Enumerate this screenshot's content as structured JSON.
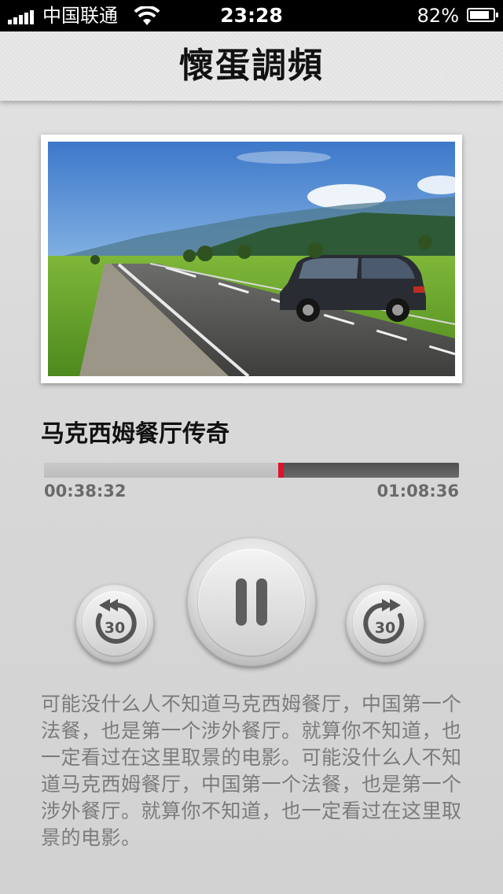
{
  "status_bar": {
    "carrier": "中国联通",
    "time": "23:28",
    "battery": "82%"
  },
  "header": {
    "logo_text": "懷蛋調頻"
  },
  "episode": {
    "title": "马克西姆餐厅传奇",
    "elapsed": "00:38:32",
    "total": "01:08:36",
    "progress_fraction": 0.57,
    "description": "可能没什么人不知道马克西姆餐厅，中国第一个法餐，也是第一个涉外餐厅。就算你不知道，也一定看过在这里取景的电影。可能没什么人不知道马克西姆餐厅，中国第一个法餐，也是第一个涉外餐厅。就算你不知道，也一定看过在这里取景的电影。"
  },
  "controls": {
    "rewind_label": "30",
    "forward_label": "30",
    "rewind_icon": "rewind-30-icon",
    "play_state_icon": "pause-icon",
    "forward_icon": "forward-30-icon"
  },
  "colors": {
    "accent": "#e0112a",
    "background": "#d7d7d7"
  }
}
